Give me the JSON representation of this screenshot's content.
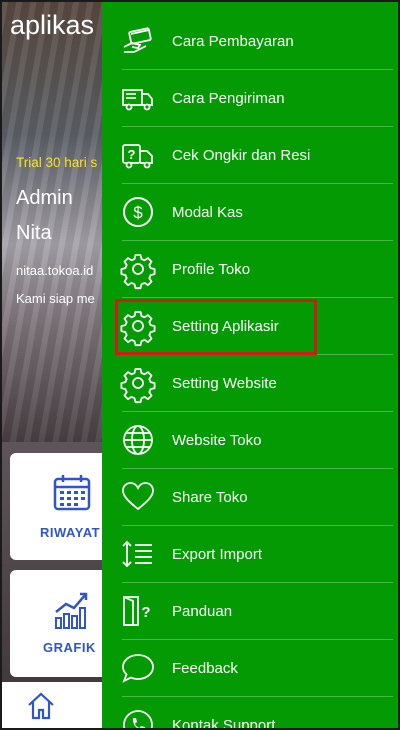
{
  "app": {
    "logo_text": "aplikas",
    "trial_text": "Trial 30 hari s",
    "admin_label": "Admin",
    "user_name": "Nita",
    "domain": "nitaa.tokoa.id",
    "tagline": "Kami siap me"
  },
  "cards": [
    {
      "label": "RIWAYAT",
      "icon": "calendar-icon"
    },
    {
      "label": "GRAFIK",
      "icon": "chart-icon"
    }
  ],
  "bottom_nav": {
    "icon": "home-icon"
  },
  "drawer": {
    "items": [
      {
        "label": "Cara Pembayaran",
        "icon": "payment-icon"
      },
      {
        "label": "Cara Pengiriman",
        "icon": "truck-icon"
      },
      {
        "label": "Cek Ongkir dan Resi",
        "icon": "shipping-check-icon"
      },
      {
        "label": "Modal Kas",
        "icon": "dollar-icon"
      },
      {
        "label": "Profile Toko",
        "icon": "gear-icon"
      },
      {
        "label": "Setting Aplikasir",
        "icon": "gear-icon",
        "highlighted": true
      },
      {
        "label": "Setting Website",
        "icon": "gear-icon"
      },
      {
        "label": "Website Toko",
        "icon": "globe-icon"
      },
      {
        "label": "Share Toko",
        "icon": "heart-icon"
      },
      {
        "label": "Export Import",
        "icon": "sort-list-icon"
      },
      {
        "label": "Panduan",
        "icon": "door-question-icon"
      },
      {
        "label": "Feedback",
        "icon": "chat-bubble-icon"
      },
      {
        "label": "Kontak Support",
        "icon": "phone-icon"
      }
    ]
  },
  "colors": {
    "drawer_bg": "#049a03",
    "highlight_border": "#d21a1a",
    "trial_text": "#f5e61c",
    "card_label": "#2f55c8"
  }
}
